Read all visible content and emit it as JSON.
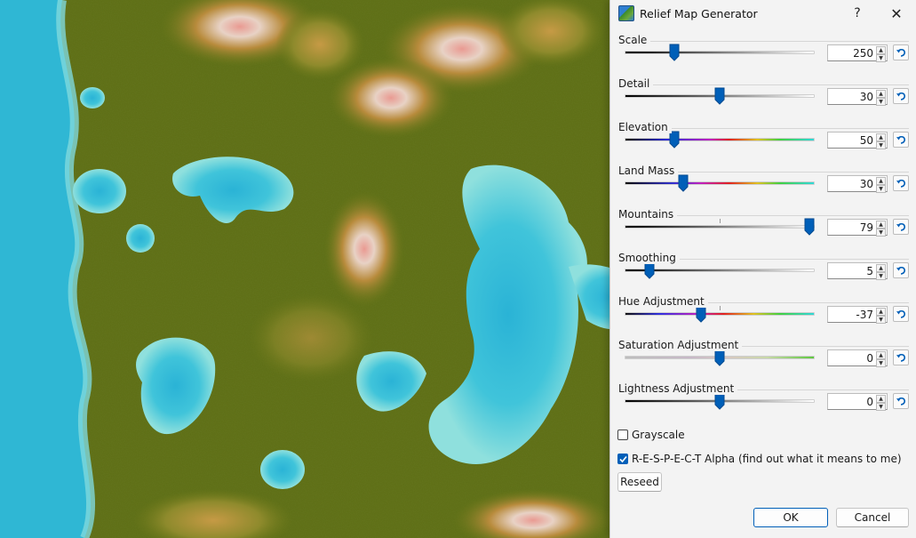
{
  "dialog": {
    "title": "Relief Map Generator",
    "help_label": "?",
    "close_label": "✕",
    "params": [
      {
        "label": "Scale",
        "value": "250",
        "fraction": 0.26,
        "track": "gray"
      },
      {
        "label": "Detail",
        "value": "30",
        "fraction": 0.5,
        "track": "gray"
      },
      {
        "label": "Elevation",
        "value": "50",
        "fraction": 0.26,
        "track": "elevation"
      },
      {
        "label": "Land Mass",
        "value": "30",
        "fraction": 0.31,
        "track": "landmass"
      },
      {
        "label": "Mountains",
        "value": "79",
        "fraction": 0.97,
        "track": "gray",
        "tick": 0.5
      },
      {
        "label": "Smoothing",
        "value": "5",
        "fraction": 0.13,
        "track": "gray"
      },
      {
        "label": "Hue Adjustment",
        "value": "-37",
        "fraction": 0.4,
        "track": "hue",
        "tick": 0.5
      },
      {
        "label": "Saturation Adjustment",
        "value": "0",
        "fraction": 0.5,
        "track": "saturation"
      },
      {
        "label": "Lightness Adjustment",
        "value": "0",
        "fraction": 0.5,
        "track": "gray"
      }
    ],
    "grayscale": {
      "label": "Grayscale",
      "checked": false
    },
    "respect_alpha": {
      "label": "R-E-S-P-E-C-T Alpha (find out what it means to me)",
      "checked": true
    },
    "reseed_label": "Reseed",
    "ok_label": "OK",
    "cancel_label": "Cancel"
  },
  "colors": {
    "accent": "#005fb8",
    "water": "#2fb7d4",
    "shallow": "#6fd6df",
    "lowland": "#5d6e14",
    "highland": "#b59040",
    "peak": "#e6b8b0"
  },
  "icons": {
    "reset": "undo-arrow-icon",
    "app": "map-icon"
  }
}
